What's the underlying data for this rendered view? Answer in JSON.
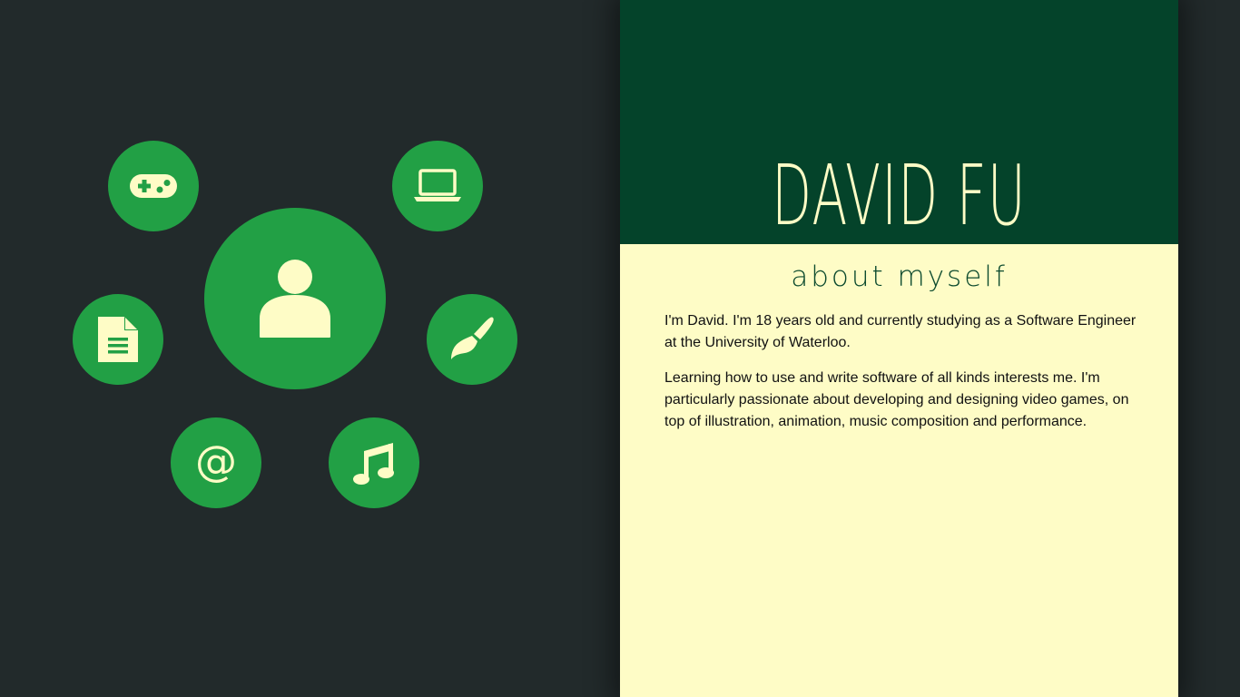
{
  "nav": {
    "items": [
      {
        "name": "about",
        "icon": "person-icon"
      },
      {
        "name": "games",
        "icon": "gamepad-icon"
      },
      {
        "name": "software",
        "icon": "laptop-icon"
      },
      {
        "name": "resume",
        "icon": "document-icon"
      },
      {
        "name": "art",
        "icon": "paintbrush-icon"
      },
      {
        "name": "contact",
        "icon": "at-sign-icon"
      },
      {
        "name": "music",
        "icon": "music-note-icon"
      }
    ],
    "contact_symbol": "@"
  },
  "header": {
    "title": "DAVID FU"
  },
  "section": {
    "heading": "about myself",
    "paragraphs": [
      "I'm David. I'm 18 years old and currently studying as a Software Engineer at the University of Waterloo.",
      "Learning how to use and write software of all kinds interests me. I'm particularly passionate about developing and designing video games, on top of illustration, animation, music composition and performance."
    ]
  },
  "colors": {
    "background": "#222a2b",
    "accent_green": "#22a045",
    "header_green": "#04432a",
    "cream": "#fefcc6"
  }
}
